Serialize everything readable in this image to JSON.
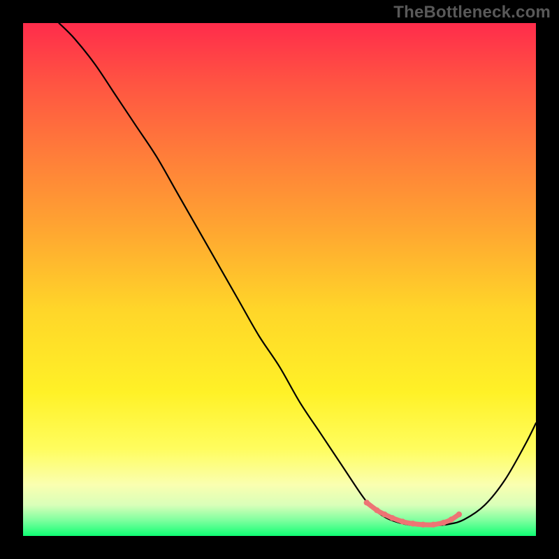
{
  "watermark": "TheBottleneck.com",
  "colors": {
    "frame_border": "#000000",
    "curve": "#000000",
    "optimal_zone": "#ed7474",
    "gradient_top": "#ff2c4b",
    "gradient_bottom": "#10ff74"
  },
  "chart_data": {
    "type": "line",
    "title": "",
    "xlabel": "",
    "ylabel": "",
    "xlim": [
      0,
      100
    ],
    "ylim": [
      0,
      100
    ],
    "x": [
      7,
      10,
      14,
      18,
      22,
      26,
      30,
      34,
      38,
      42,
      46,
      50,
      54,
      58,
      62,
      66,
      68,
      70,
      72,
      75,
      78,
      80,
      83,
      86,
      90,
      94,
      98,
      100
    ],
    "y": [
      100,
      97,
      92,
      86,
      80,
      74,
      67,
      60,
      53,
      46,
      39,
      33,
      26,
      20,
      14,
      8,
      5.5,
      4,
      3,
      2.2,
      2,
      2,
      2.3,
      3.2,
      6,
      11,
      18,
      22
    ],
    "series": [
      {
        "name": "bottleneck-curve",
        "description": "Main black V-shaped curve"
      }
    ],
    "optimal_zone": {
      "name": "optimal-range",
      "description": "Highlighted near-zero bottleneck region along the curve bottom",
      "x_start": 67,
      "x_end": 85,
      "dots_x": [
        67,
        69,
        70.5,
        72,
        74,
        76,
        78,
        80,
        82,
        83.5,
        85
      ],
      "dots_y": [
        6.5,
        5,
        4.2,
        3.5,
        2.8,
        2.4,
        2.2,
        2.2,
        2.6,
        3.2,
        4.2
      ]
    },
    "axes_visible": false,
    "grid": false
  }
}
